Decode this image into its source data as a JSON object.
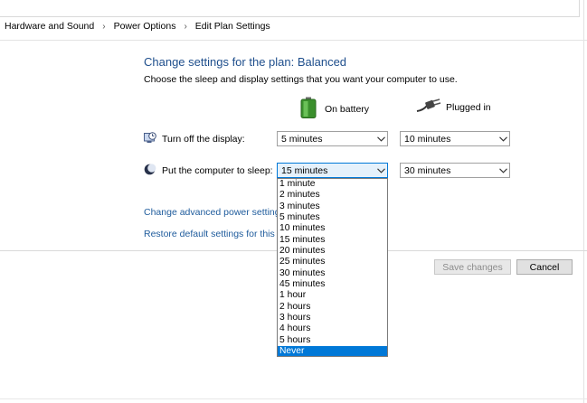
{
  "breadcrumb": [
    "Hardware and Sound",
    "Power Options",
    "Edit Plan Settings"
  ],
  "heading": "Change settings for the plan: Balanced",
  "subtitle": "Choose the sleep and display settings that you want your computer to use.",
  "columns": {
    "battery": "On battery",
    "plugged": "Plugged in"
  },
  "rows": {
    "display": {
      "label": "Turn off the display:",
      "battery": "5 minutes",
      "plugged": "10 minutes"
    },
    "sleep": {
      "label": "Put the computer to sleep:",
      "battery": "15 minutes",
      "plugged": "30 minutes"
    }
  },
  "links": {
    "advanced": "Change advanced power settings",
    "restore": "Restore default settings for this plan"
  },
  "dropdown": {
    "options": [
      "1 minute",
      "2 minutes",
      "3 minutes",
      "5 minutes",
      "10 minutes",
      "15 minutes",
      "20 minutes",
      "25 minutes",
      "30 minutes",
      "45 minutes",
      "1 hour",
      "2 hours",
      "3 hours",
      "4 hours",
      "5 hours",
      "Never"
    ],
    "highlighted": "Never"
  },
  "buttons": {
    "save": "Save changes",
    "cancel": "Cancel"
  },
  "colors": {
    "heading": "#1e4e8c",
    "link": "#1e5b9c",
    "highlight": "#0078d7"
  }
}
